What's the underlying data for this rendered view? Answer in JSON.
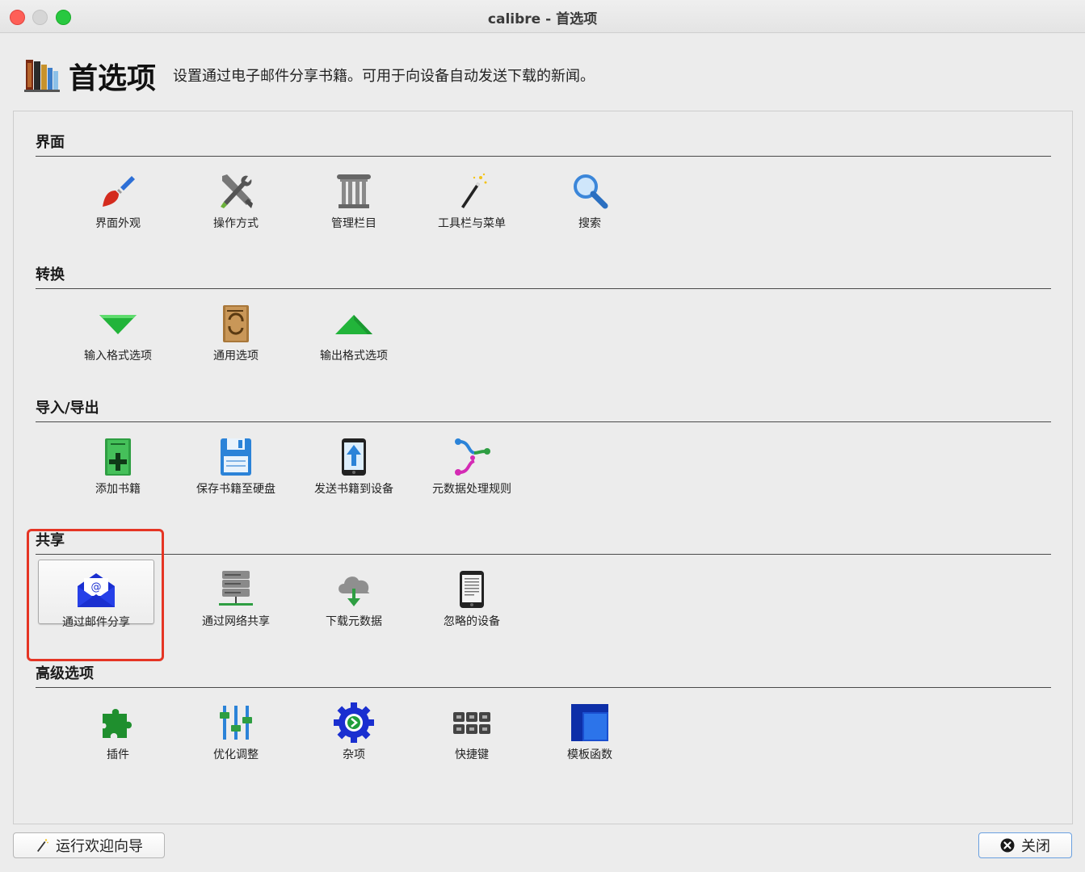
{
  "window": {
    "title": "calibre - 首选项"
  },
  "header": {
    "title": "首选项",
    "description": "设置通过电子邮件分享书籍。可用于向设备自动发送下载的新闻。"
  },
  "sections": [
    {
      "title": "界面",
      "items": [
        {
          "label": "界面外观",
          "icon": "paintbrush-icon"
        },
        {
          "label": "操作方式",
          "icon": "tools-icon"
        },
        {
          "label": "管理栏目",
          "icon": "column-icon"
        },
        {
          "label": "工具栏与菜单",
          "icon": "magic-wand-icon"
        },
        {
          "label": "搜索",
          "icon": "search-icon"
        }
      ]
    },
    {
      "title": "转换",
      "items": [
        {
          "label": "输入格式选项",
          "icon": "arrow-down-icon"
        },
        {
          "label": "通用选项",
          "icon": "convert-book-icon"
        },
        {
          "label": "输出格式选项",
          "icon": "arrow-up-icon"
        }
      ]
    },
    {
      "title": "导入/导出",
      "items": [
        {
          "label": "添加书籍",
          "icon": "add-book-icon"
        },
        {
          "label": "保存书籍至硬盘",
          "icon": "save-disk-icon"
        },
        {
          "label": "发送书籍到设备",
          "icon": "send-device-icon"
        },
        {
          "label": "元数据处理规则",
          "icon": "rules-icon"
        }
      ]
    },
    {
      "title": "共享",
      "items": [
        {
          "label": "通过邮件分享",
          "icon": "mail-icon",
          "selected": true
        },
        {
          "label": "通过网络共享",
          "icon": "server-icon"
        },
        {
          "label": "下载元数据",
          "icon": "cloud-download-icon"
        },
        {
          "label": "忽略的设备",
          "icon": "tablet-icon"
        }
      ]
    },
    {
      "title": "高级选项",
      "items": [
        {
          "label": "插件",
          "icon": "puzzle-icon"
        },
        {
          "label": "优化调整",
          "icon": "sliders-icon"
        },
        {
          "label": "杂项",
          "icon": "gear-icon"
        },
        {
          "label": "快捷键",
          "icon": "keyboard-icon"
        },
        {
          "label": "模板函数",
          "icon": "template-icon"
        }
      ]
    }
  ],
  "footer": {
    "wizard_label": "运行欢迎向导",
    "close_label": "关闭"
  },
  "colors": {
    "highlight": "#e53524",
    "close_border": "#6aa0e0"
  }
}
